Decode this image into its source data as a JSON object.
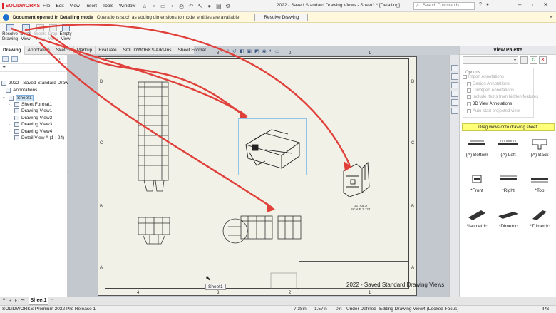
{
  "app": {
    "logo_text": "SOLIDWORKS",
    "menu": [
      "File",
      "Edit",
      "View",
      "Insert",
      "Tools",
      "Window"
    ],
    "title": "2022 - Saved Standard Drawing Views - Sheet1 * [Detailing]",
    "search_placeholder": "Search Commands"
  },
  "info_bar": {
    "strong": "Document opened in Detailing mode",
    "text": "Operations such as adding dimensions to model entities are available.",
    "button": "Resolve Drawing"
  },
  "commands": {
    "resolve": [
      "Resolve",
      "Drawing"
    ],
    "detail": [
      "Detail",
      "View"
    ],
    "break": [
      "Break",
      "View"
    ],
    "crop": [
      "Crop",
      "View"
    ],
    "empty": [
      "Empty",
      "View"
    ]
  },
  "tabs": [
    "Drawing",
    "Annotation",
    "Sketch",
    "Markup",
    "Evaluate",
    "SOLIDWORKS Add-Ins",
    "Sheet Format"
  ],
  "tree": {
    "root": "2022 - Saved Standard Drawing",
    "annotations": "Annotations",
    "sheet": "Sheet1",
    "children": [
      "Sheet Format1",
      "Drawing View1",
      "Drawing View2",
      "Drawing View3",
      "Drawing View4",
      "Detail View A (1 : 24)"
    ]
  },
  "sheet": {
    "zone_numbers_top": [
      "3",
      "2",
      "1"
    ],
    "zone_numbers_bottom": [
      "4",
      "3",
      "2",
      "1"
    ],
    "zone_letters": [
      "D",
      "C",
      "B",
      "A"
    ],
    "title_block_text": "2022 - Saved Standard Drawing Views",
    "detail_label": [
      "DETAIL A",
      "SCALE 1 : 24"
    ],
    "drag_tooltip": "Sheet1"
  },
  "palette": {
    "title": "View Palette",
    "options_label": "Options",
    "options": [
      "Import Annotations",
      "Design Annotations",
      "DimXpert Annotations",
      "Include items from hidden features",
      "3D View Annotations",
      "Auto-start projected view"
    ],
    "hint": "Drag views onto drawing sheet.",
    "views": [
      "(A) Bottom",
      "(A) Left",
      "(A) Back",
      "*Front",
      "*Right",
      "*Top",
      "*Isometric",
      "*Dimetric",
      "*Trimetric"
    ]
  },
  "sheet_tab": "Sheet1",
  "status": {
    "product": "SOLIDWORKS Premium 2022 Pre Release 1",
    "x": "7.38in",
    "y": "1.57in",
    "z": "0in",
    "state": "Under Defined",
    "editing": "Editing Drawing View4 (Locked Focus)",
    "units": "IPS"
  },
  "colors": {
    "brand": "#d9262c",
    "arrow": "#e0403a",
    "hint_bg": "#ffff7a"
  }
}
